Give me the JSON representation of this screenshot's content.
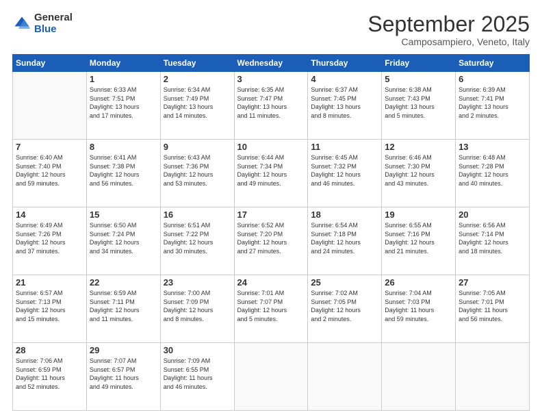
{
  "logo": {
    "general": "General",
    "blue": "Blue"
  },
  "header": {
    "month": "September 2025",
    "location": "Camposampiero, Veneto, Italy"
  },
  "weekdays": [
    "Sunday",
    "Monday",
    "Tuesday",
    "Wednesday",
    "Thursday",
    "Friday",
    "Saturday"
  ],
  "weeks": [
    [
      {
        "day": "",
        "text": ""
      },
      {
        "day": "1",
        "text": "Sunrise: 6:33 AM\nSunset: 7:51 PM\nDaylight: 13 hours\nand 17 minutes."
      },
      {
        "day": "2",
        "text": "Sunrise: 6:34 AM\nSunset: 7:49 PM\nDaylight: 13 hours\nand 14 minutes."
      },
      {
        "day": "3",
        "text": "Sunrise: 6:35 AM\nSunset: 7:47 PM\nDaylight: 13 hours\nand 11 minutes."
      },
      {
        "day": "4",
        "text": "Sunrise: 6:37 AM\nSunset: 7:45 PM\nDaylight: 13 hours\nand 8 minutes."
      },
      {
        "day": "5",
        "text": "Sunrise: 6:38 AM\nSunset: 7:43 PM\nDaylight: 13 hours\nand 5 minutes."
      },
      {
        "day": "6",
        "text": "Sunrise: 6:39 AM\nSunset: 7:41 PM\nDaylight: 13 hours\nand 2 minutes."
      }
    ],
    [
      {
        "day": "7",
        "text": "Sunrise: 6:40 AM\nSunset: 7:40 PM\nDaylight: 12 hours\nand 59 minutes."
      },
      {
        "day": "8",
        "text": "Sunrise: 6:41 AM\nSunset: 7:38 PM\nDaylight: 12 hours\nand 56 minutes."
      },
      {
        "day": "9",
        "text": "Sunrise: 6:43 AM\nSunset: 7:36 PM\nDaylight: 12 hours\nand 53 minutes."
      },
      {
        "day": "10",
        "text": "Sunrise: 6:44 AM\nSunset: 7:34 PM\nDaylight: 12 hours\nand 49 minutes."
      },
      {
        "day": "11",
        "text": "Sunrise: 6:45 AM\nSunset: 7:32 PM\nDaylight: 12 hours\nand 46 minutes."
      },
      {
        "day": "12",
        "text": "Sunrise: 6:46 AM\nSunset: 7:30 PM\nDaylight: 12 hours\nand 43 minutes."
      },
      {
        "day": "13",
        "text": "Sunrise: 6:48 AM\nSunset: 7:28 PM\nDaylight: 12 hours\nand 40 minutes."
      }
    ],
    [
      {
        "day": "14",
        "text": "Sunrise: 6:49 AM\nSunset: 7:26 PM\nDaylight: 12 hours\nand 37 minutes."
      },
      {
        "day": "15",
        "text": "Sunrise: 6:50 AM\nSunset: 7:24 PM\nDaylight: 12 hours\nand 34 minutes."
      },
      {
        "day": "16",
        "text": "Sunrise: 6:51 AM\nSunset: 7:22 PM\nDaylight: 12 hours\nand 30 minutes."
      },
      {
        "day": "17",
        "text": "Sunrise: 6:52 AM\nSunset: 7:20 PM\nDaylight: 12 hours\nand 27 minutes."
      },
      {
        "day": "18",
        "text": "Sunrise: 6:54 AM\nSunset: 7:18 PM\nDaylight: 12 hours\nand 24 minutes."
      },
      {
        "day": "19",
        "text": "Sunrise: 6:55 AM\nSunset: 7:16 PM\nDaylight: 12 hours\nand 21 minutes."
      },
      {
        "day": "20",
        "text": "Sunrise: 6:56 AM\nSunset: 7:14 PM\nDaylight: 12 hours\nand 18 minutes."
      }
    ],
    [
      {
        "day": "21",
        "text": "Sunrise: 6:57 AM\nSunset: 7:13 PM\nDaylight: 12 hours\nand 15 minutes."
      },
      {
        "day": "22",
        "text": "Sunrise: 6:59 AM\nSunset: 7:11 PM\nDaylight: 12 hours\nand 11 minutes."
      },
      {
        "day": "23",
        "text": "Sunrise: 7:00 AM\nSunset: 7:09 PM\nDaylight: 12 hours\nand 8 minutes."
      },
      {
        "day": "24",
        "text": "Sunrise: 7:01 AM\nSunset: 7:07 PM\nDaylight: 12 hours\nand 5 minutes."
      },
      {
        "day": "25",
        "text": "Sunrise: 7:02 AM\nSunset: 7:05 PM\nDaylight: 12 hours\nand 2 minutes."
      },
      {
        "day": "26",
        "text": "Sunrise: 7:04 AM\nSunset: 7:03 PM\nDaylight: 11 hours\nand 59 minutes."
      },
      {
        "day": "27",
        "text": "Sunrise: 7:05 AM\nSunset: 7:01 PM\nDaylight: 11 hours\nand 56 minutes."
      }
    ],
    [
      {
        "day": "28",
        "text": "Sunrise: 7:06 AM\nSunset: 6:59 PM\nDaylight: 11 hours\nand 52 minutes."
      },
      {
        "day": "29",
        "text": "Sunrise: 7:07 AM\nSunset: 6:57 PM\nDaylight: 11 hours\nand 49 minutes."
      },
      {
        "day": "30",
        "text": "Sunrise: 7:09 AM\nSunset: 6:55 PM\nDaylight: 11 hours\nand 46 minutes."
      },
      {
        "day": "",
        "text": ""
      },
      {
        "day": "",
        "text": ""
      },
      {
        "day": "",
        "text": ""
      },
      {
        "day": "",
        "text": ""
      }
    ]
  ]
}
